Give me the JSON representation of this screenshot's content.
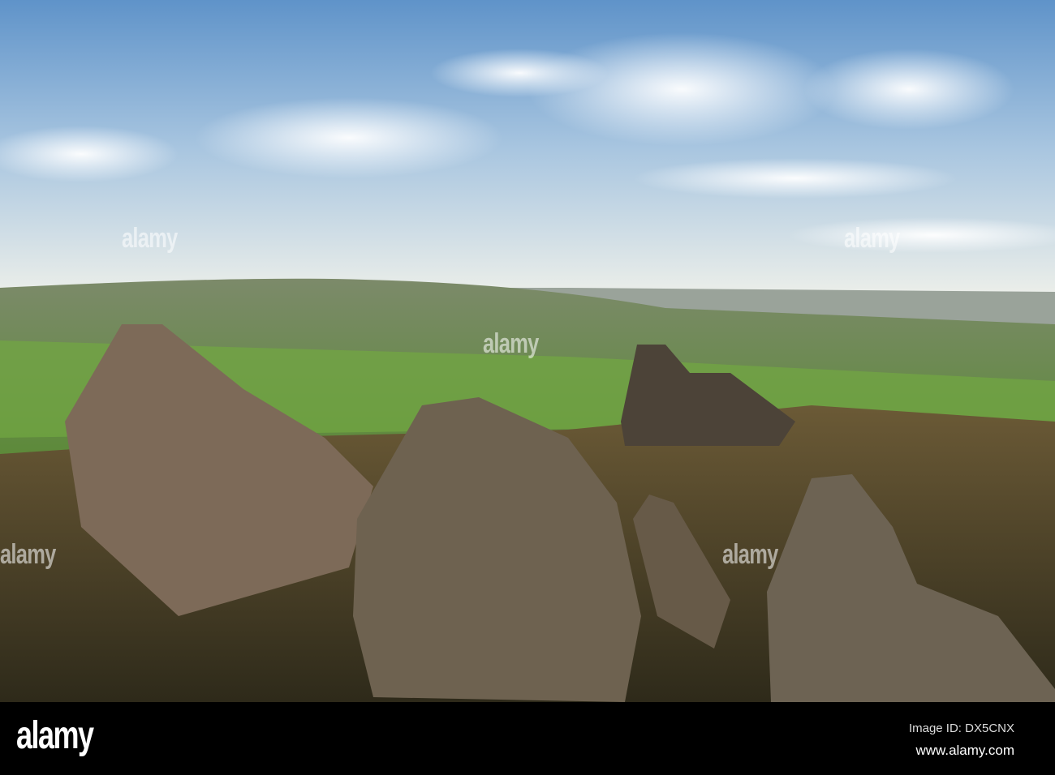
{
  "photo": {
    "subject": "rocky gritstone outcrop overlooking green valley",
    "colors": {
      "sky_top": "#5f93c9",
      "sky_horizon": "#e9ecea",
      "hills": "#5f9a3a",
      "rock": "#6b5a4a",
      "grass": "#6a5a2a"
    }
  },
  "watermark": {
    "text": "alamy"
  },
  "footer": {
    "logo": "alamy",
    "image_id": "Image ID: DX5CNX",
    "website": "www.alamy.com"
  }
}
